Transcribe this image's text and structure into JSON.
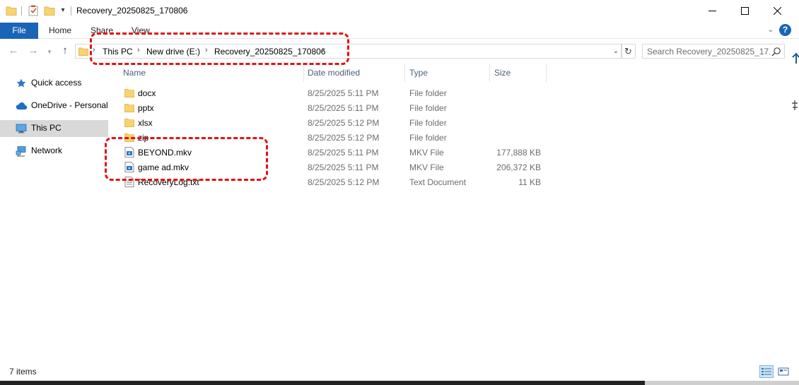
{
  "window": {
    "title": "Recovery_20250825_170806"
  },
  "ribbon": {
    "tabs": [
      "File",
      "Home",
      "Share",
      "View"
    ],
    "help_label": "?"
  },
  "address": {
    "crumbs": [
      "This PC",
      "New drive (E:)",
      "Recovery_20250825_170806"
    ]
  },
  "search": {
    "placeholder": "Search Recovery_20250825_17..."
  },
  "sidebar": {
    "items": [
      {
        "label": "Quick access",
        "icon": "star-icon"
      },
      {
        "label": "OneDrive - Personal",
        "icon": "cloud-icon"
      },
      {
        "label": "This PC",
        "icon": "computer-icon",
        "selected": true
      },
      {
        "label": "Network",
        "icon": "network-icon"
      }
    ]
  },
  "columns": {
    "name": "Name",
    "date": "Date modified",
    "type": "Type",
    "size": "Size"
  },
  "files": [
    {
      "name": "docx",
      "date": "8/25/2025 5:11 PM",
      "type": "File folder",
      "size": "",
      "icon": "folder-icon"
    },
    {
      "name": "pptx",
      "date": "8/25/2025 5:11 PM",
      "type": "File folder",
      "size": "",
      "icon": "folder-icon"
    },
    {
      "name": "xlsx",
      "date": "8/25/2025 5:12 PM",
      "type": "File folder",
      "size": "",
      "icon": "folder-icon"
    },
    {
      "name": "zip",
      "date": "8/25/2025 5:12 PM",
      "type": "File folder",
      "size": "",
      "icon": "folder-icon"
    },
    {
      "name": "BEYOND.mkv",
      "date": "8/25/2025 5:11 PM",
      "type": "MKV File",
      "size": "177,888 KB",
      "icon": "video-file-icon"
    },
    {
      "name": "game ad.mkv",
      "date": "8/25/2025 5:11 PM",
      "type": "MKV File",
      "size": "206,372 KB",
      "icon": "video-file-icon"
    },
    {
      "name": "RecoveryLog.txt",
      "date": "8/25/2025 5:12 PM",
      "type": "Text Document",
      "size": "11 KB",
      "icon": "text-file-icon"
    }
  ],
  "status": {
    "item_count": "7 items"
  },
  "colors": {
    "accent": "#1a64b8",
    "highlight_annotation": "#e01414",
    "selected_bg": "#d9d9d9"
  }
}
